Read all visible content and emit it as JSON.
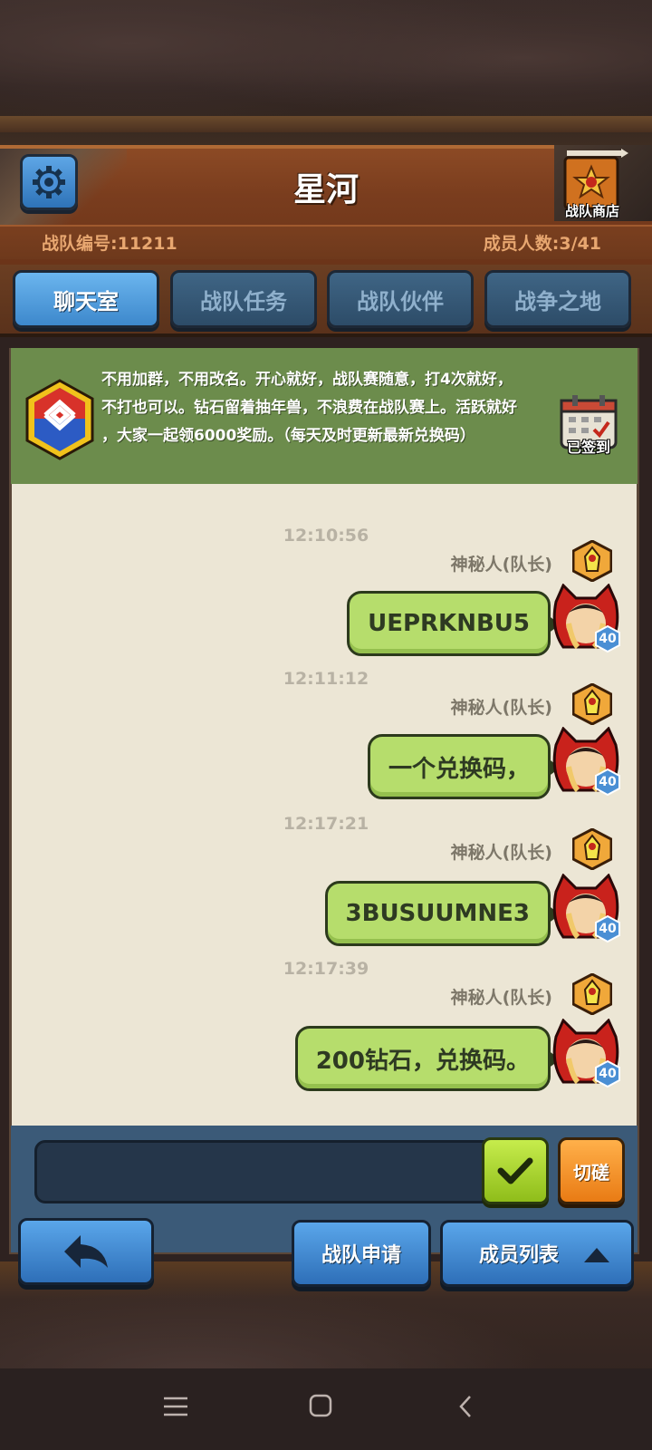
{
  "header": {
    "title": "星河",
    "team_id": "战队编号:11211",
    "member_count": "成员人数:3/41",
    "shop_label": "战队商店"
  },
  "tabs": [
    {
      "label": "聊天室",
      "active": true
    },
    {
      "label": "战队任务",
      "active": false
    },
    {
      "label": "战队伙伴",
      "active": false
    },
    {
      "label": "战争之地",
      "active": false
    }
  ],
  "notice": {
    "lines": [
      "不用加群，不用改名。开心就好，战队赛随意，打4次就好，",
      "不打也可以。钻石留着抽年兽，不浪费在战队赛上。活跃就好",
      "，大家一起领6000奖励。（每天及时更新最新兑换码）"
    ],
    "checkin_label": "已签到"
  },
  "messages": [
    {
      "time": "12:10:56",
      "sender": "神秘人(队长)",
      "text": "UEPRKNBU5",
      "level": "40"
    },
    {
      "time": "12:11:12",
      "sender": "神秘人(队长)",
      "text": "一个兑换码，",
      "level": "40"
    },
    {
      "time": "12:17:21",
      "sender": "神秘人(队长)",
      "text": "3BUSUUMNE3",
      "level": "40"
    },
    {
      "time": "12:17:39",
      "sender": "神秘人(队长)",
      "text": "200钻石，兑换码。",
      "level": "40"
    }
  ],
  "input": {
    "value": "",
    "placeholder": ""
  },
  "buttons": {
    "switch": "切磋",
    "apply": "战队申请",
    "members": "成员列表"
  },
  "icons": {
    "settings": "gear-icon",
    "shop": "shop-sign-icon",
    "send": "checkmark-icon",
    "back": "back-arrow-icon",
    "members_toggle": "caret-up-icon"
  },
  "colors": {
    "bubble": "#b6dd6c",
    "notice_bg": "#6c8c4c",
    "tab_active": "#4a96d8",
    "send": "#a8d32a",
    "switch": "#f29528"
  }
}
